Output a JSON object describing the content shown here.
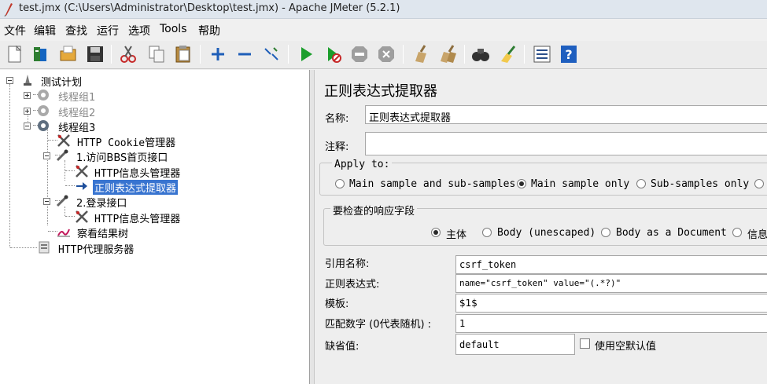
{
  "window": {
    "title": "test.jmx (C:\\Users\\Administrator\\Desktop\\test.jmx) - Apache JMeter (5.2.1)"
  },
  "menu": [
    "文件",
    "编辑",
    "查找",
    "运行",
    "选项",
    "Tools",
    "帮助"
  ],
  "toolbar_icons": [
    "new-icon",
    "templates-icon",
    "open-icon",
    "save-icon",
    "cut-icon",
    "copy-icon",
    "paste-icon",
    "expand-icon",
    "collapse-icon",
    "toggle-icon",
    "start-icon",
    "start-no-pause-icon",
    "stop-icon",
    "shutdown-icon",
    "clear-icon",
    "clear-all-icon",
    "search-icon",
    "reset-search-icon",
    "function-helper-icon",
    "help-icon"
  ],
  "tree": {
    "root": "测试计划",
    "group1": "线程组1",
    "group2": "线程组2",
    "group3": "线程组3",
    "cookie_manager": "HTTP Cookie管理器",
    "sampler1": "1.访问BBS首页接口",
    "header_manager1": "HTTP信息头管理器",
    "regex_extractor": "正则表达式提取器",
    "sampler2": "2.登录接口",
    "header_manager2": "HTTP信息头管理器",
    "results_tree": "察看结果树",
    "proxy_server": "HTTP代理服务器"
  },
  "panel": {
    "title": "正则表达式提取器",
    "name_label": "名称:",
    "name_value": "正则表达式提取器",
    "comment_label": "注释:",
    "comment_value": "",
    "apply_to": {
      "legend": "Apply to:",
      "options": [
        "Main sample and sub-samples",
        "Main sample only",
        "Sub-samples only"
      ],
      "selected": 1
    },
    "field_to_check": {
      "legend": "要检查的响应字段",
      "options": [
        "主体",
        "Body (unescaped)",
        "Body as a Document",
        "信息"
      ],
      "selected": 0
    },
    "ref_name_label": "引用名称:",
    "ref_name_value": "csrf_token",
    "regex_label": "正则表达式:",
    "regex_value": "name=\"csrf_token\" value=\"(.*?)\"",
    "template_label": "模板:",
    "template_value": "$1$",
    "match_no_label": "匹配数字 (0代表随机) :",
    "match_no_value": "1",
    "default_label": "缺省值:",
    "default_value": "default",
    "use_empty_label": "使用空默认值",
    "use_empty_checked": false
  }
}
